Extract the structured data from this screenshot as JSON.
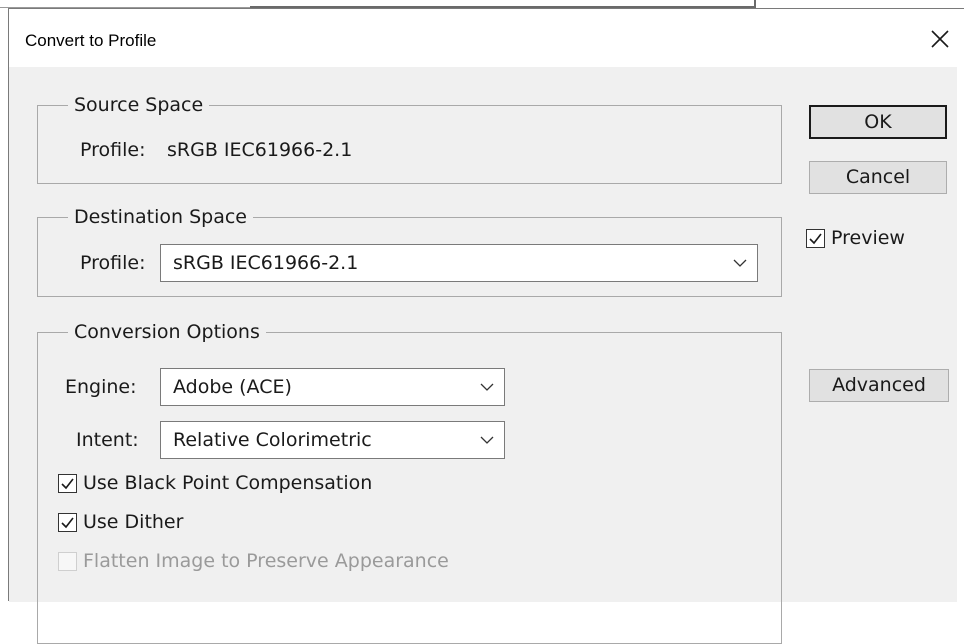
{
  "window": {
    "title": "Convert to Profile"
  },
  "source_space": {
    "legend": "Source Space",
    "profile_label": "Profile:",
    "profile_value": "sRGB IEC61966-2.1"
  },
  "destination_space": {
    "legend": "Destination Space",
    "profile_label": "Profile:",
    "profile_value": "sRGB IEC61966-2.1"
  },
  "conversion_options": {
    "legend": "Conversion Options",
    "engine_label": "Engine:",
    "engine_value": "Adobe (ACE)",
    "intent_label": "Intent:",
    "intent_value": "Relative Colorimetric",
    "black_point_label": "Use Black Point Compensation",
    "black_point_checked": true,
    "dither_label": "Use Dither",
    "dither_checked": true,
    "flatten_label": "Flatten Image to Preserve Appearance",
    "flatten_checked": false,
    "flatten_enabled": false
  },
  "buttons": {
    "ok": "OK",
    "cancel": "Cancel",
    "advanced": "Advanced"
  },
  "preview": {
    "label": "Preview",
    "checked": true
  },
  "icons": [
    "close-icon",
    "chevron-down-icon",
    "checkmark-icon"
  ]
}
